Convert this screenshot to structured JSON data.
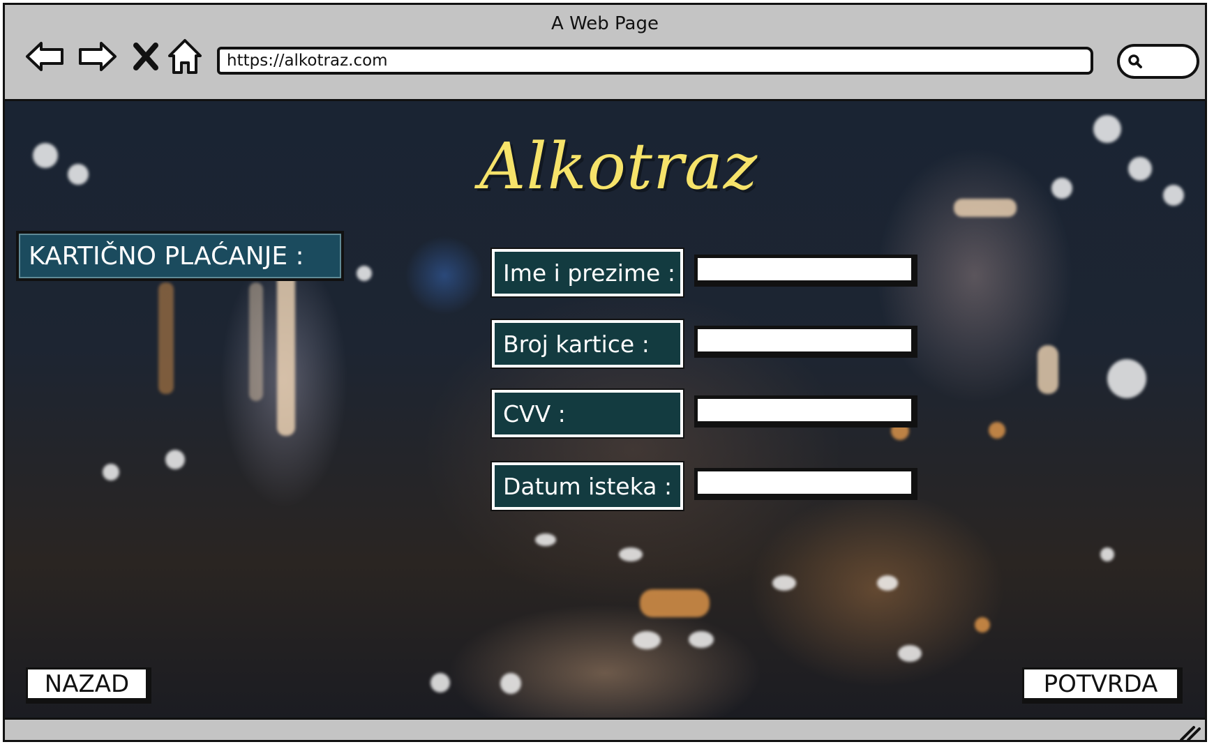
{
  "window": {
    "title": "A Web Page"
  },
  "browser": {
    "url": "https://alkotraz.com",
    "nav_icons": [
      "back-arrow-icon",
      "forward-arrow-icon",
      "close-x-icon",
      "home-icon"
    ],
    "search_icon": "search-icon"
  },
  "page": {
    "logo": "Alkotraz",
    "section_title": "KARTIČNO PLAĆANJE :",
    "form": {
      "name_label": "Ime i prezime :",
      "card_label": "Broj kartice :",
      "cvv_label": "CVV :",
      "expiry_label": "Datum isteka :",
      "name_value": "",
      "card_value": "",
      "cvv_value": "",
      "expiry_value": ""
    },
    "back_button": "NAZAD",
    "confirm_button": "POTVRDA"
  },
  "colors": {
    "label_bg": "#133b40",
    "section_bg": "#1b4b5e",
    "logo": "#f6e36a",
    "chrome": "#c4c4c4"
  }
}
